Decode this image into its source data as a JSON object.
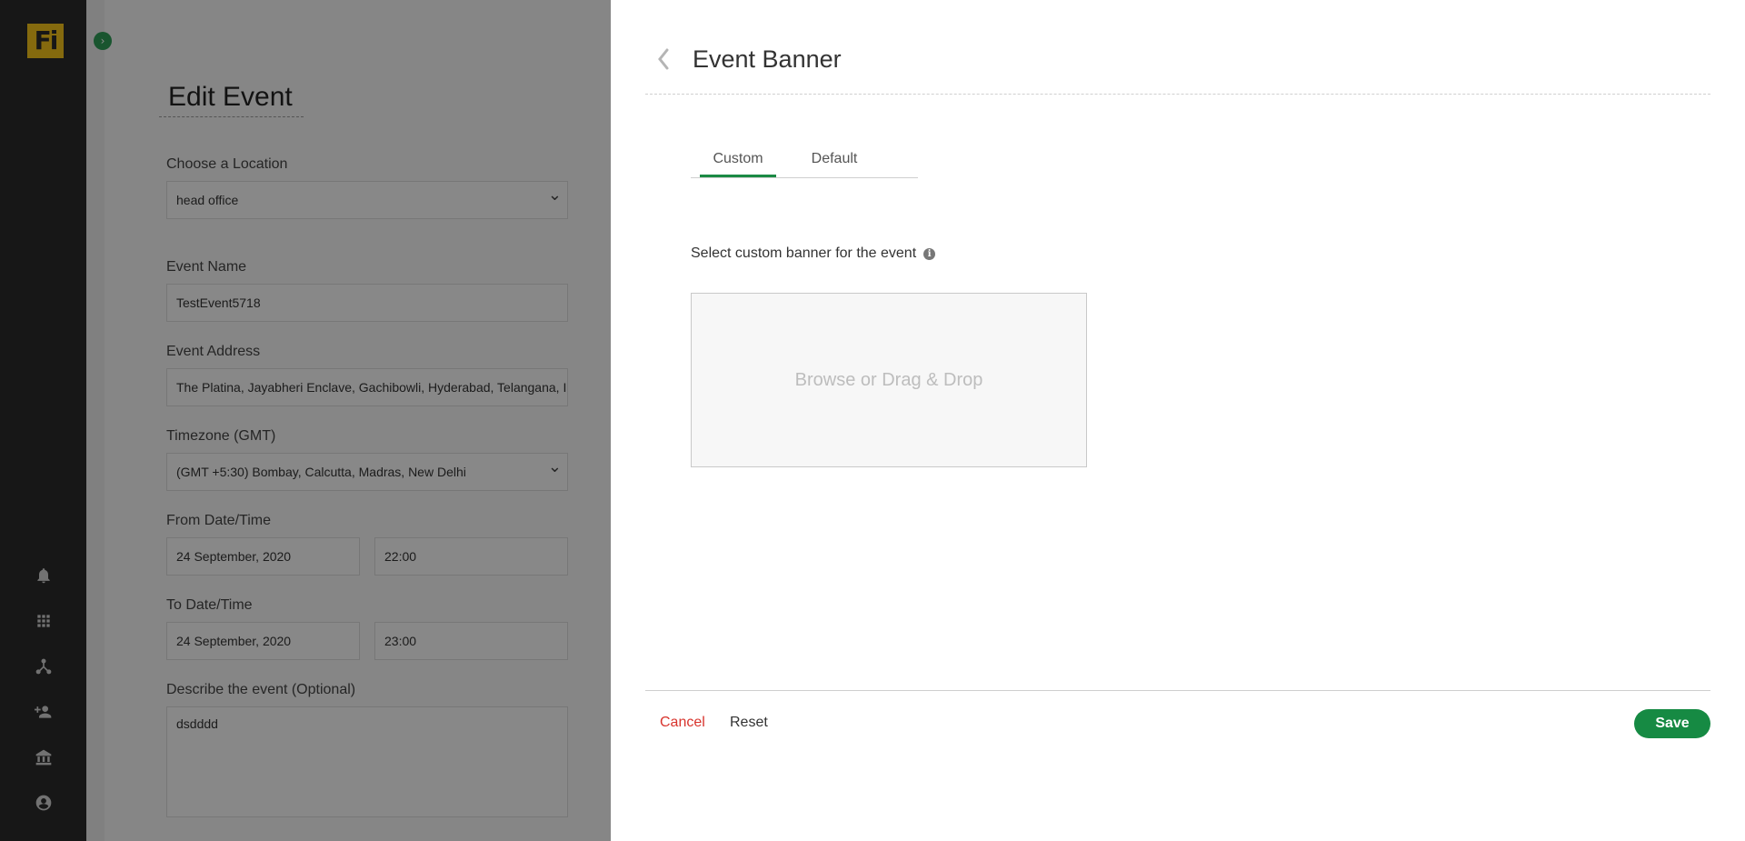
{
  "sidebar": {
    "logo_text": "Fi",
    "icons": [
      "bell-icon",
      "grid-icon",
      "network-icon",
      "add-user-icon",
      "building-icon",
      "account-icon"
    ]
  },
  "main": {
    "title": "Edit Event",
    "fields": {
      "location": {
        "label": "Choose a Location",
        "value": "head office"
      },
      "name": {
        "label": "Event Name",
        "value": "TestEvent5718"
      },
      "address": {
        "label": "Event Address",
        "value": "The Platina, Jayabheri Enclave, Gachibowli, Hyderabad, Telangana, In"
      },
      "timezone": {
        "label": "Timezone (GMT)",
        "value": "(GMT +5:30) Bombay, Calcutta, Madras, New Delhi"
      },
      "from": {
        "label": "From Date/Time",
        "date": "24 September, 2020",
        "time": "22:00"
      },
      "to": {
        "label": "To Date/Time",
        "date": "24 September, 2020",
        "time": "23:00"
      },
      "description": {
        "label": "Describe the event (Optional)",
        "value": "dsdddd"
      }
    }
  },
  "panel": {
    "title": "Event Banner",
    "tabs": [
      {
        "label": "Custom",
        "active": true
      },
      {
        "label": "Default",
        "active": false
      }
    ],
    "instruction": "Select custom banner for the event",
    "dropzone_text": "Browse or Drag & Drop",
    "cancel_label": "Cancel",
    "reset_label": "Reset",
    "save_label": "Save"
  },
  "colors": {
    "accent": "#168a43",
    "cancel": "#d8342d",
    "logo": "#f2c21b",
    "sidebar": "#2b2b2b"
  }
}
